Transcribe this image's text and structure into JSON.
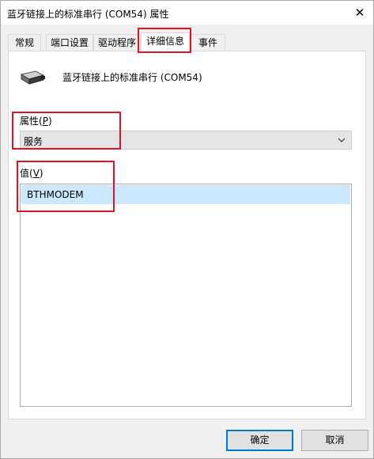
{
  "window": {
    "title": "蓝牙链接上的标准串行 (COM54) 属性",
    "close_glyph": "✕"
  },
  "tabs": [
    {
      "label": "常规",
      "active": false
    },
    {
      "label": "端口设置",
      "active": false
    },
    {
      "label": "驱动程序",
      "active": false
    },
    {
      "label": "详细信息",
      "active": true
    },
    {
      "label": "事件",
      "active": false
    }
  ],
  "device": {
    "icon": "serial-port-icon",
    "name": "蓝牙链接上的标准串行 (COM54)"
  },
  "property": {
    "label_prefix": "属性(",
    "label_access": "P",
    "label_suffix": ")",
    "selected": "服务"
  },
  "value": {
    "label_prefix": "值(",
    "label_access": "V",
    "label_suffix": ")",
    "items": [
      "BTHMODEM"
    ]
  },
  "buttons": {
    "ok": "确定",
    "cancel": "取消"
  },
  "colors": {
    "highlight_box": "#e81123",
    "selection": "#cce8ff",
    "primary_border": "#0078d7"
  }
}
